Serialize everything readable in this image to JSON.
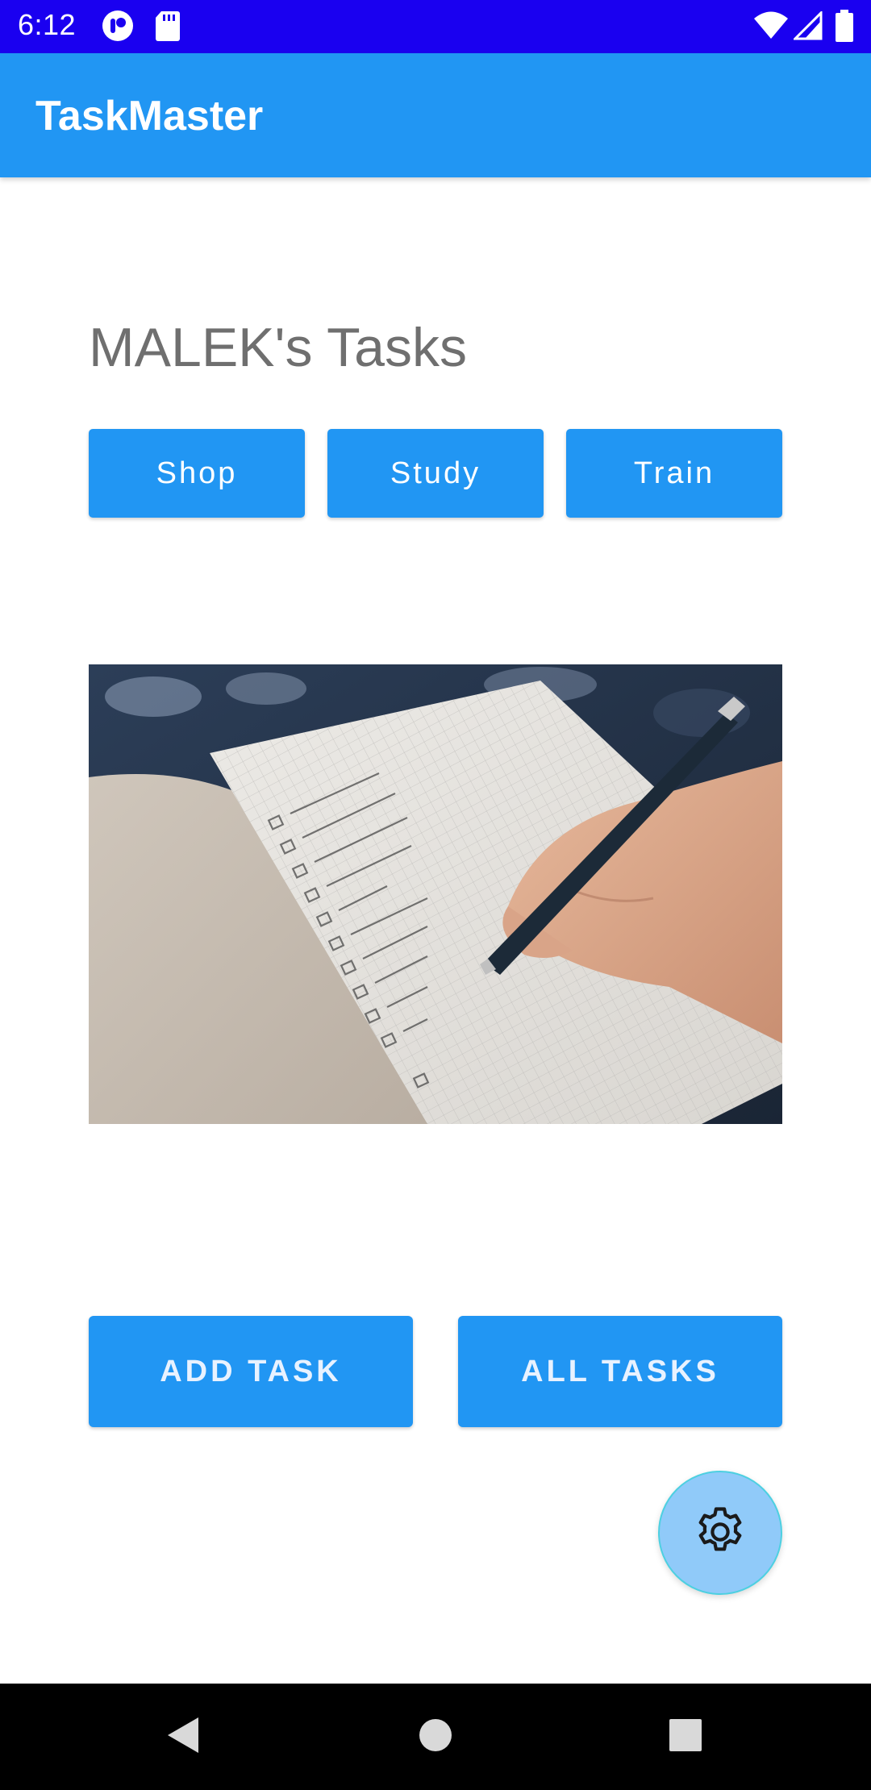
{
  "status_bar": {
    "time": "6:12",
    "icons": [
      "app-notification-icon",
      "sd-card-icon",
      "wifi-icon",
      "signal-icon",
      "battery-icon"
    ]
  },
  "app_bar": {
    "title": "TaskMaster",
    "color": "#2196f3"
  },
  "main": {
    "heading": "MALEK's Tasks",
    "category_buttons": [
      {
        "label": "Shop"
      },
      {
        "label": "Study"
      },
      {
        "label": "Train"
      }
    ],
    "image_description_icon": "checklist-notebook-photo",
    "actions": {
      "add_task": "ADD TASK",
      "all_tasks": "ALL TASKS"
    },
    "fab_icon": "gear-icon"
  },
  "navigation": {
    "buttons": [
      "back-icon",
      "home-icon",
      "recents-icon"
    ]
  },
  "colors": {
    "status_bar": "#1a00f0",
    "primary": "#2196f3",
    "fab": "#90caf9"
  }
}
